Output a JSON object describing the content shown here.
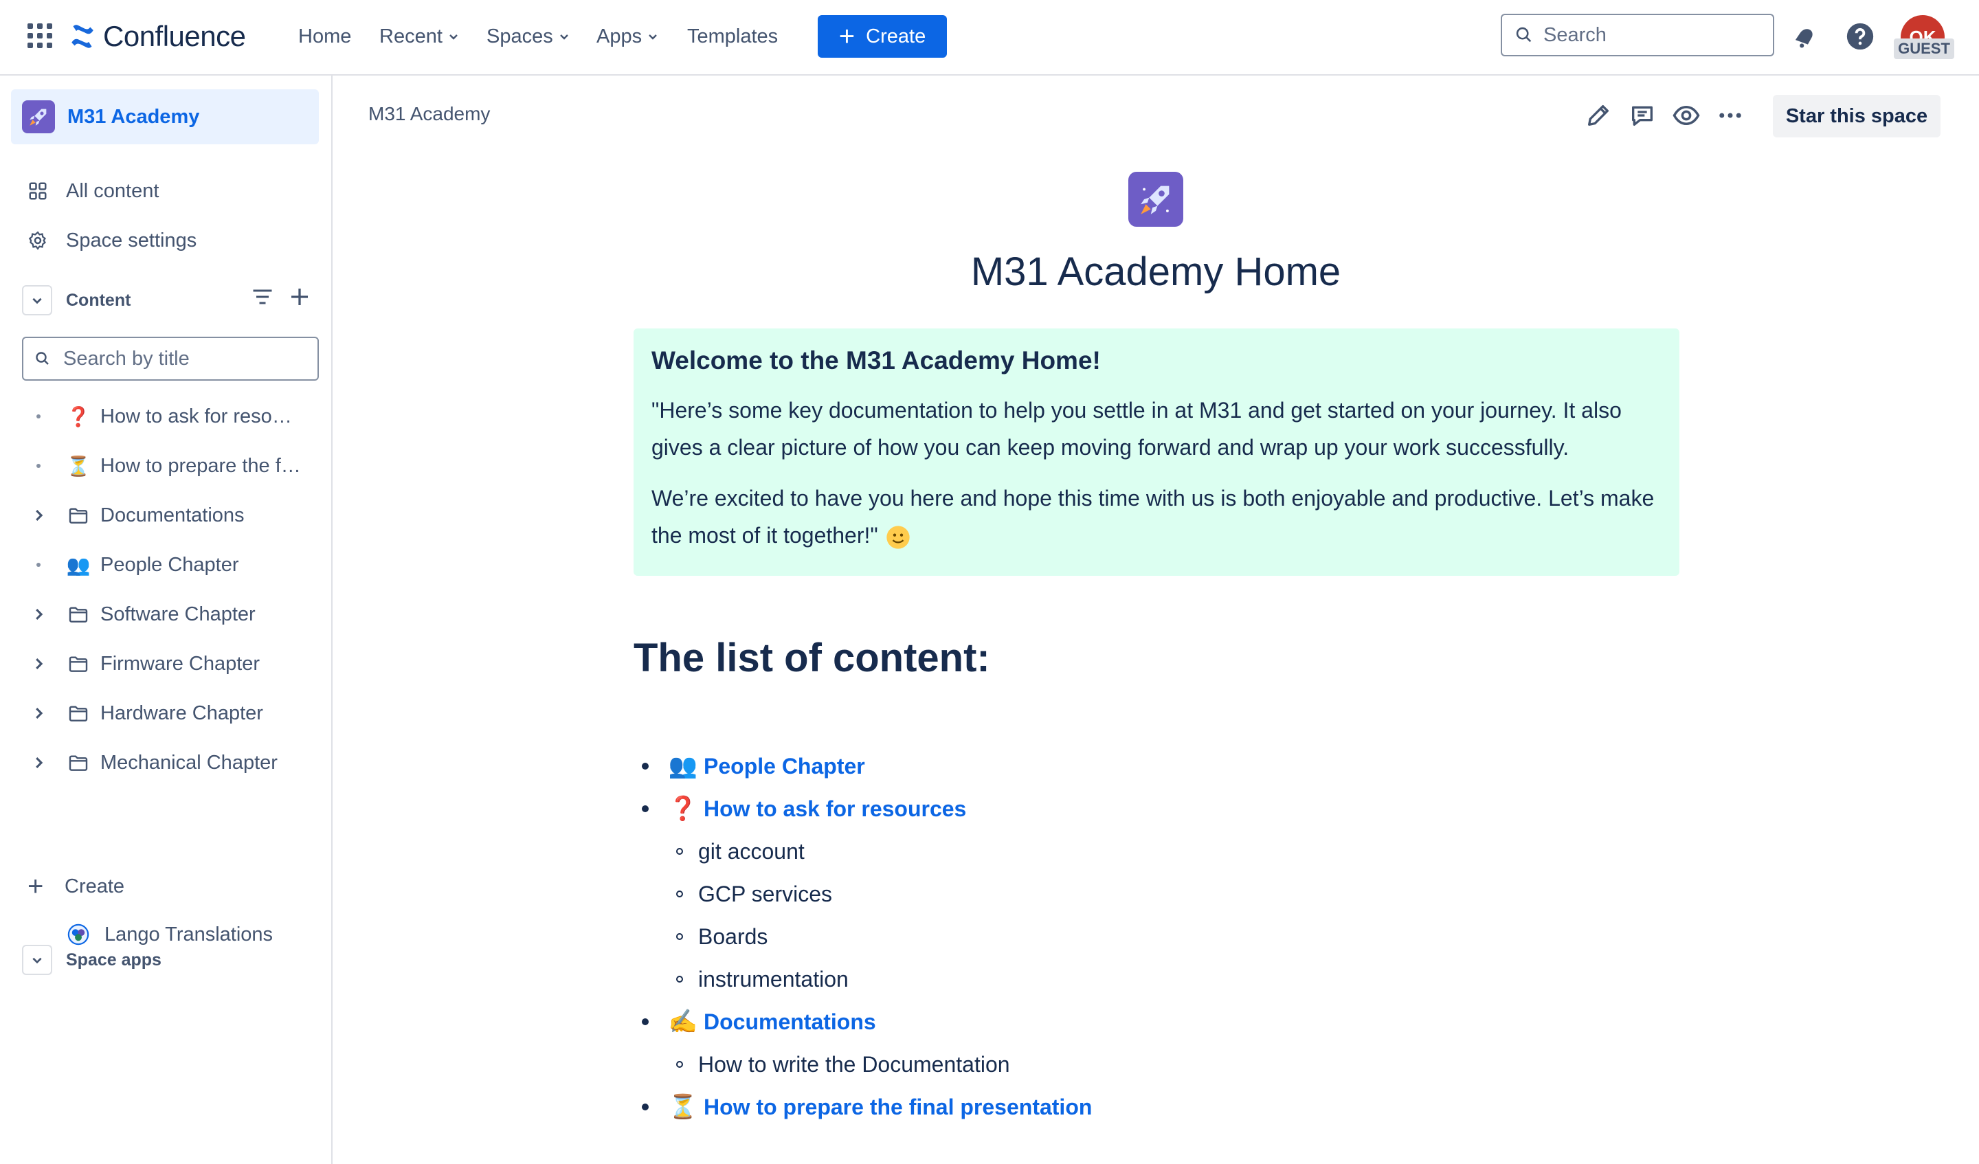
{
  "topnav": {
    "product": "Confluence",
    "items": [
      "Home",
      "Recent",
      "Spaces",
      "Apps",
      "Templates"
    ],
    "create_label": "Create",
    "search_placeholder": "Search",
    "avatar_initials": "OK",
    "guest_badge": "GUEST"
  },
  "sidebar": {
    "space_name": "M31 Academy",
    "links": [
      "All content",
      "Space settings"
    ],
    "content_header": "Content",
    "search_placeholder": "Search by title",
    "tree": [
      {
        "label": "How to ask for reso…",
        "icon": "question-mark-icon",
        "glyph": "❓",
        "expandable": false
      },
      {
        "label": "How to prepare the f…",
        "icon": "hourglass-icon",
        "glyph": "⏳",
        "expandable": false
      },
      {
        "label": "Documentations",
        "icon": "folder-icon",
        "glyph": "",
        "expandable": true
      },
      {
        "label": "People Chapter",
        "icon": "people-icon",
        "glyph": "👥",
        "expandable": false
      },
      {
        "label": "Software Chapter",
        "icon": "folder-icon",
        "glyph": "",
        "expandable": true
      },
      {
        "label": "Firmware Chapter",
        "icon": "folder-icon",
        "glyph": "",
        "expandable": true
      },
      {
        "label": "Hardware Chapter",
        "icon": "folder-icon",
        "glyph": "",
        "expandable": true
      },
      {
        "label": "Mechanical Chapter",
        "icon": "folder-icon",
        "glyph": "",
        "expandable": true
      }
    ],
    "create_label": "Create",
    "space_apps_header": "Space apps",
    "apps": [
      "Lango Translations"
    ]
  },
  "main": {
    "breadcrumb": "M31 Academy",
    "star_label": "Star this space",
    "title": "M31 Academy Home",
    "panel": {
      "heading": "Welcome to the M31 Academy Home!",
      "p1": "\"Here’s some key documentation to help you settle in at M31 and get started on your journey. It also gives a clear picture of how you can keep moving forward and wrap up your work successfully.",
      "p2": "We’re excited to have you here and hope this time with us is both enjoyable and productive. Let’s make the most of it together!\""
    },
    "list_heading": "The list of content:",
    "list": [
      {
        "level": 1,
        "emoji": "👥",
        "text": "People Chapter",
        "link": true
      },
      {
        "level": 1,
        "emoji": "❓",
        "text": "How to ask for resources",
        "link": true
      },
      {
        "level": 2,
        "text": "git account"
      },
      {
        "level": 2,
        "text": "GCP services"
      },
      {
        "level": 2,
        "text": "Boards"
      },
      {
        "level": 2,
        "text": "instrumentation"
      },
      {
        "level": 1,
        "emoji": "✍️",
        "text": "Documentations",
        "link": true
      },
      {
        "level": 2,
        "text": "How to write the Documentation"
      },
      {
        "level": 1,
        "emoji": "⏳",
        "text": "How to prepare the final presentation",
        "link": true
      }
    ]
  },
  "colors": {
    "accent": "#0c66e4",
    "panel_bg": "#dcfff1",
    "text": "#172b4d"
  }
}
